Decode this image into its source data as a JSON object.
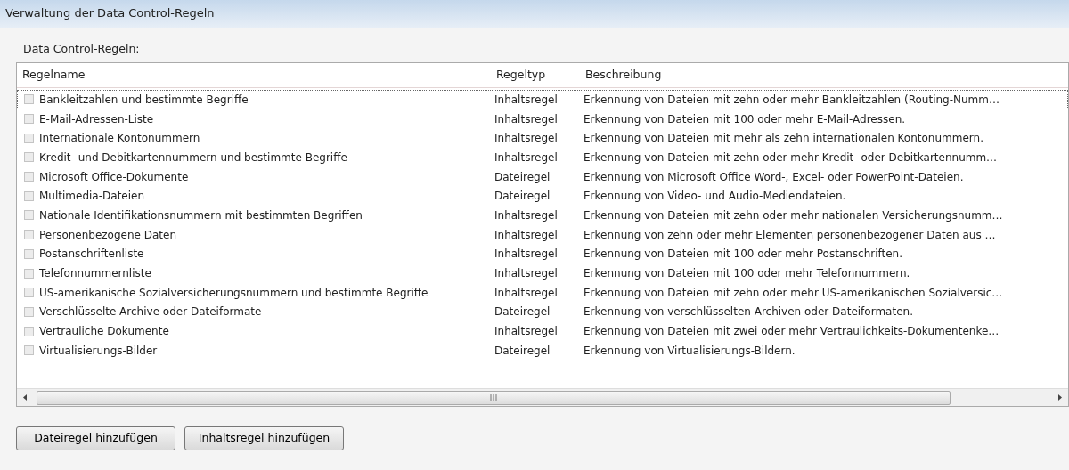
{
  "window": {
    "title": "Verwaltung der Data Control-Regeln"
  },
  "list_label": "Data Control-Regeln:",
  "table": {
    "columns": [
      "Regelname",
      "Regeltyp",
      "Beschreibung"
    ],
    "rows": [
      {
        "name": "Bankleitzahlen und bestimmte Begriffe",
        "type": "Inhaltsregel",
        "description": "Erkennung von Dateien mit zehn oder mehr Bankleitzahlen (Routing-Numm…",
        "checked": false,
        "focused": true
      },
      {
        "name": "E-Mail-Adressen-Liste",
        "type": "Inhaltsregel",
        "description": "Erkennung von Dateien mit 100 oder mehr E-Mail-Adressen.",
        "checked": false,
        "focused": false
      },
      {
        "name": "Internationale Kontonummern",
        "type": "Inhaltsregel",
        "description": "Erkennung von Dateien mit mehr als zehn internationalen Kontonummern.",
        "checked": false,
        "focused": false
      },
      {
        "name": "Kredit- und Debitkartennummern und bestimmte Begriffe",
        "type": "Inhaltsregel",
        "description": "Erkennung von Dateien mit zehn oder mehr Kredit- oder Debitkartennumm…",
        "checked": false,
        "focused": false
      },
      {
        "name": "Microsoft Office-Dokumente",
        "type": "Dateiregel",
        "description": "Erkennung von Microsoft Office Word-, Excel- oder PowerPoint-Dateien.",
        "checked": false,
        "focused": false
      },
      {
        "name": "Multimedia-Dateien",
        "type": "Dateiregel",
        "description": "Erkennung von Video- und Audio-Mediendateien.",
        "checked": false,
        "focused": false
      },
      {
        "name": "Nationale Identifikationsnummern mit bestimmten Begriffen",
        "type": "Inhaltsregel",
        "description": "Erkennung von Dateien mit zehn oder mehr nationalen Versicherungsnumm…",
        "checked": false,
        "focused": false
      },
      {
        "name": "Personenbezogene Daten",
        "type": "Inhaltsregel",
        "description": "Erkennung von zehn oder mehr Elementen personenbezogener Daten aus …",
        "checked": false,
        "focused": false
      },
      {
        "name": "Postanschriftenliste",
        "type": "Inhaltsregel",
        "description": "Erkennung von Dateien mit 100 oder mehr Postanschriften.",
        "checked": false,
        "focused": false
      },
      {
        "name": "Telefonnummernliste",
        "type": "Inhaltsregel",
        "description": "Erkennung von Dateien mit 100 oder mehr Telefonnummern.",
        "checked": false,
        "focused": false
      },
      {
        "name": "US-amerikanische Sozialversicherungsnummern und bestimmte Begriffe",
        "type": "Inhaltsregel",
        "description": "Erkennung von Dateien mit zehn oder mehr US-amerikanischen Sozialversic…",
        "checked": false,
        "focused": false
      },
      {
        "name": "Verschlüsselte Archive oder Dateiformate",
        "type": "Dateiregel",
        "description": "Erkennung von verschlüsselten Archiven oder Dateiformaten.",
        "checked": false,
        "focused": false
      },
      {
        "name": "Vertrauliche Dokumente",
        "type": "Inhaltsregel",
        "description": "Erkennung von Dateien mit zwei oder mehr Vertraulichkeits-Dokumentenke…",
        "checked": false,
        "focused": false
      },
      {
        "name": "Virtualisierungs-Bilder",
        "type": "Dateiregel",
        "description": "Erkennung von Virtualisierungs-Bildern.",
        "checked": false,
        "focused": false
      }
    ]
  },
  "buttons": [
    "Dateiregel hinzufügen",
    "Inhaltsregel hinzufügen"
  ]
}
